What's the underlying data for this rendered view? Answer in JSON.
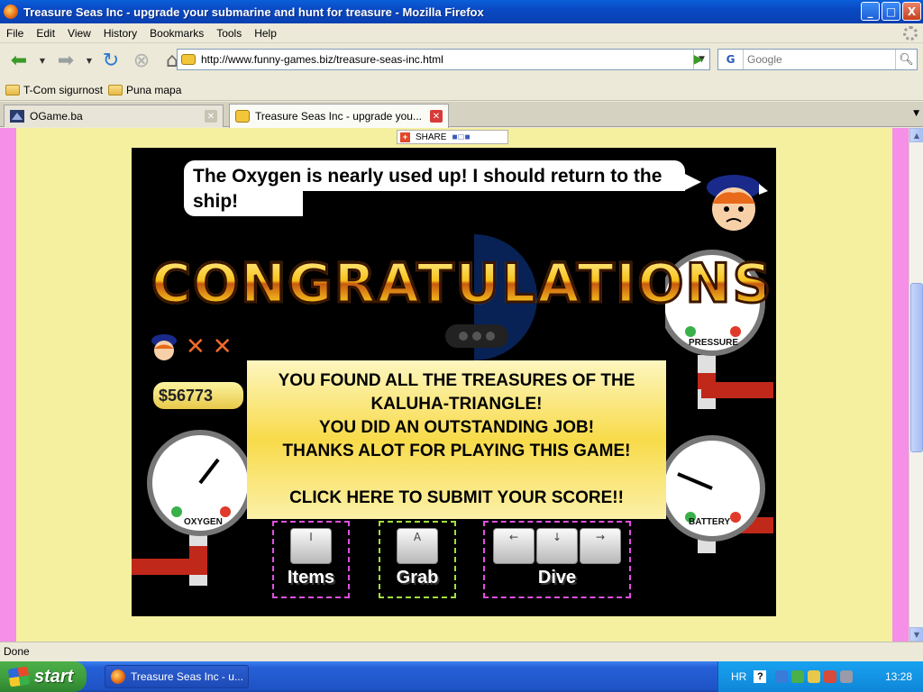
{
  "window": {
    "title": "Treasure Seas Inc - upgrade your submarine and hunt for treasure - Mozilla Firefox",
    "buttons": {
      "minimize": "_",
      "maximize": "□",
      "close": "X"
    }
  },
  "menu": [
    "File",
    "Edit",
    "View",
    "History",
    "Bookmarks",
    "Tools",
    "Help"
  ],
  "nav": {
    "url": "http://www.funny-games.biz/treasure-seas-inc.html",
    "search_engine": "G",
    "search_placeholder": "Google"
  },
  "bookmarks": [
    "T-Com sigurnost",
    "Puna mapa"
  ],
  "tabs": [
    {
      "label": "OGame.ba",
      "active": false
    },
    {
      "label": "Treasure Seas Inc - upgrade you...",
      "active": true
    }
  ],
  "page": {
    "share_label": "SHARE",
    "speech": "The Oxygen is nearly used up! I should return to the ship!",
    "headline": "CONGRATULATIONS!",
    "message_lines": [
      "YOU FOUND ALL THE TREASURES OF THE",
      "KALUHA-TRIANGLE!",
      "YOU DID AN OUTSTANDING JOB!",
      "THANKS ALOT FOR PLAYING THIS GAME!"
    ],
    "submit_text": "CLICK HERE TO SUBMIT YOUR SCORE!!",
    "money": "$56773",
    "gauges": {
      "pressure": "PRESSURE",
      "oxygen": "OXYGEN",
      "battery": "BATTERY"
    },
    "controls": {
      "items": {
        "key": "I",
        "label": "Items"
      },
      "grab": {
        "key": "A",
        "label": "Grab"
      },
      "dive": {
        "keys": [
          "←",
          "↓",
          "→"
        ],
        "label": "Dive"
      }
    }
  },
  "status": "Done",
  "taskbar": {
    "start": "start",
    "item": "Treasure Seas Inc - u...",
    "lang": "HR",
    "help": "?",
    "clock": "13:28"
  },
  "colors": {
    "page_bg": "#f4f0a0",
    "side_bars": "#f58fe8",
    "game_bg": "#000000",
    "accent_orange": "#f06a2a"
  }
}
